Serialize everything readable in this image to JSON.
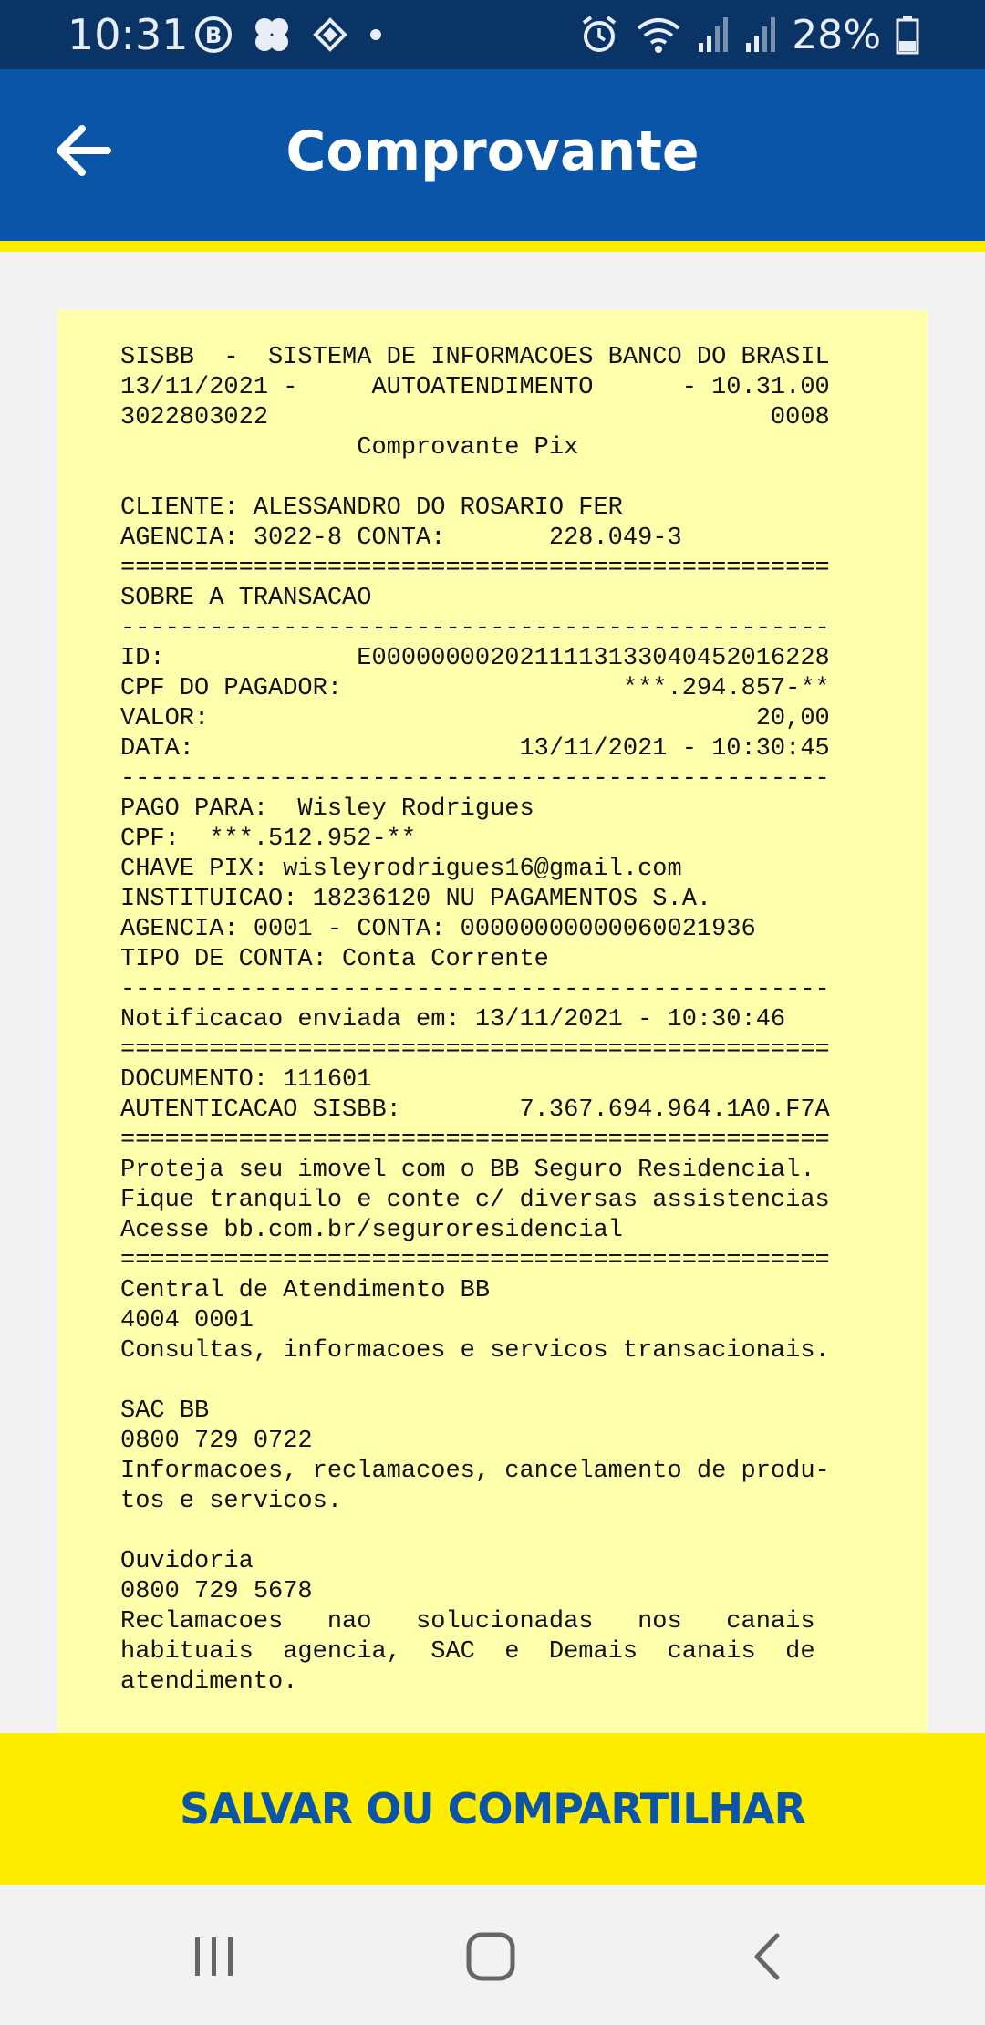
{
  "status_bar": {
    "time": "10:31",
    "battery_percent": "28%",
    "left_icons": [
      "b-badge-icon",
      "clover-icon",
      "bb-logo-icon",
      "dot-icon"
    ],
    "right_icons": [
      "alarm-icon",
      "wifi-icon",
      "signal-icon",
      "signal-icon",
      "battery-icon"
    ]
  },
  "header": {
    "title": "Comprovante",
    "back_icon": "arrow-left-icon",
    "accent_color": "#0a55a8",
    "stripe_color": "#ffed00"
  },
  "receipt": {
    "background": "#ffffac",
    "lines": [
      "SISBB  -  SISTEMA DE INFORMACOES BANCO DO BRASIL",
      "13/11/2021 -     AUTOATENDIMENTO      - 10.31.00",
      "3022803022                                  0008",
      "                Comprovante Pix",
      "",
      "CLIENTE: ALESSANDRO DO ROSARIO FER",
      "AGENCIA: 3022-8 CONTA:       228.049-3",
      "================================================",
      "SOBRE A TRANSACAO",
      "------------------------------------------------",
      "ID:             E00000000202111131330404520162​28",
      "CPF DO PAGADOR:                   ***.294.857-**",
      "VALOR:                                     20,00",
      "DATA:                      13/11/2021 - 10:30:45",
      "------------------------------------------------",
      "PAGO PARA:  Wisley Rodrigues",
      "CPF:  ***.512.952-**",
      "CHAVE PIX: wisleyrodrigues16@gmail.com",
      "INSTITUICAO: 18236120 NU PAGAMENTOS S.A.",
      "AGENCIA: 0001 - CONTA: 00000000000060021936",
      "TIPO DE CONTA: Conta Corrente",
      "------------------------------------------------",
      "Notificacao enviada em: 13/11/2021 - 10:30:46",
      "================================================",
      "DOCUMENTO: 111601",
      "AUTENTICACAO SISBB:        7.367.694.964.1A0.F7A",
      "================================================",
      "Proteja seu imovel com o BB Seguro Residencial.",
      "Fique tranquilo e conte c/ diversas assistencias",
      "Acesse bb.com.br/seguroresidencial",
      "================================================",
      "Central de Atendimento BB",
      "4004 0001",
      "Consultas, informacoes e servicos transacionais.",
      "",
      "SAC BB",
      "0800 729 0722",
      "Informacoes, reclamacoes, cancelamento de produ-",
      "tos e servicos.",
      "",
      "Ouvidoria",
      "0800 729 5678",
      "Reclamacoes   nao   solucionadas   nos   canais",
      "habituais  agencia,  SAC  e  Demais  canais  de",
      "atendimento."
    ]
  },
  "action": {
    "label": "SALVAR OU COMPARTILHAR",
    "background": "#ffed00",
    "text_color": "#0a55a8"
  },
  "nav_bar": {
    "buttons": [
      "recent-apps-icon",
      "home-icon",
      "back-icon"
    ]
  }
}
